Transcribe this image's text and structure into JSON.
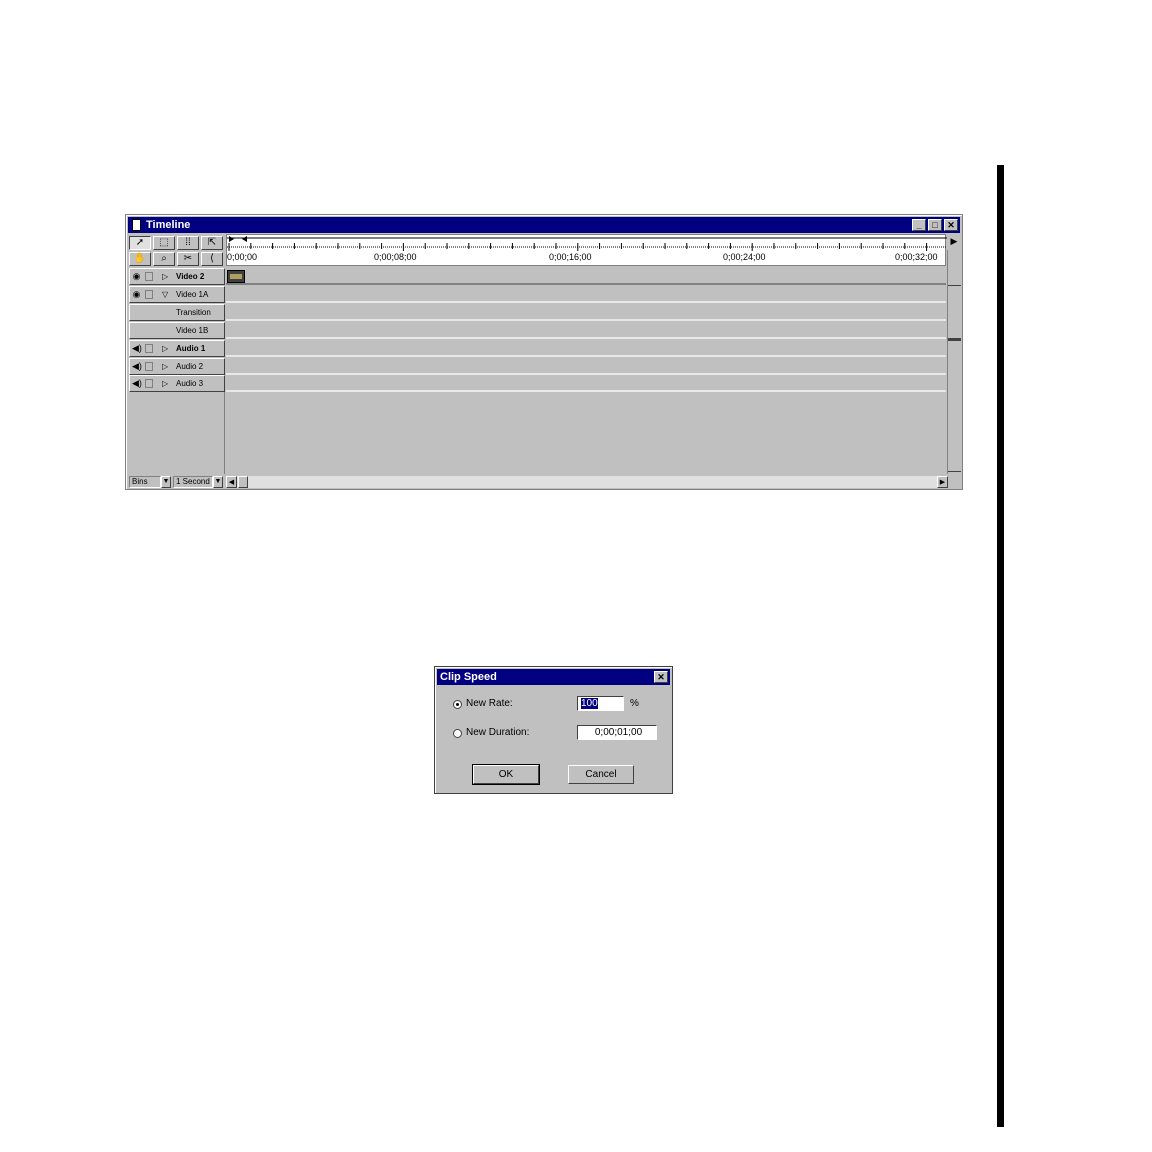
{
  "timeline": {
    "title": "Timeline",
    "window_buttons": {
      "minimize": "_",
      "maximize": "□",
      "close": "✕"
    },
    "tools": [
      "selection-tool",
      "range-select-tool",
      "block-select-tool",
      "track-select-tool",
      "hand-tool",
      "zoom-tool",
      "razor-tool",
      "in-out-tool"
    ],
    "ruler": {
      "start_label": "0;00;00",
      "labels": [
        "0;00;08;00",
        "0;00;16;00",
        "0;00;24;00",
        "0;00;32;00"
      ]
    },
    "tracks": [
      {
        "name": "Video 2",
        "bold": true,
        "type": "video",
        "expanded": false
      },
      {
        "name": "Video 1A",
        "bold": false,
        "type": "video",
        "expanded": true
      },
      {
        "name": "Transition",
        "bold": false,
        "type": "sub"
      },
      {
        "name": "Video 1B",
        "bold": false,
        "type": "sub"
      },
      {
        "name": "Audio 1",
        "bold": true,
        "type": "audio",
        "expanded": false
      },
      {
        "name": "Audio 2",
        "bold": false,
        "type": "audio",
        "expanded": false
      },
      {
        "name": "Audio 3",
        "bold": false,
        "type": "audio",
        "expanded": false
      }
    ],
    "statusbar": {
      "view_option": "Bins",
      "time_unit": "1 Second"
    }
  },
  "clip_speed": {
    "title": "Clip Speed",
    "new_rate_label": "New Rate:",
    "new_rate_value": "100",
    "percent_sign": "%",
    "new_duration_label": "New Duration:",
    "new_duration_value": "0;00;01;00",
    "ok_label": "OK",
    "cancel_label": "Cancel",
    "selected_option": "new-rate"
  }
}
